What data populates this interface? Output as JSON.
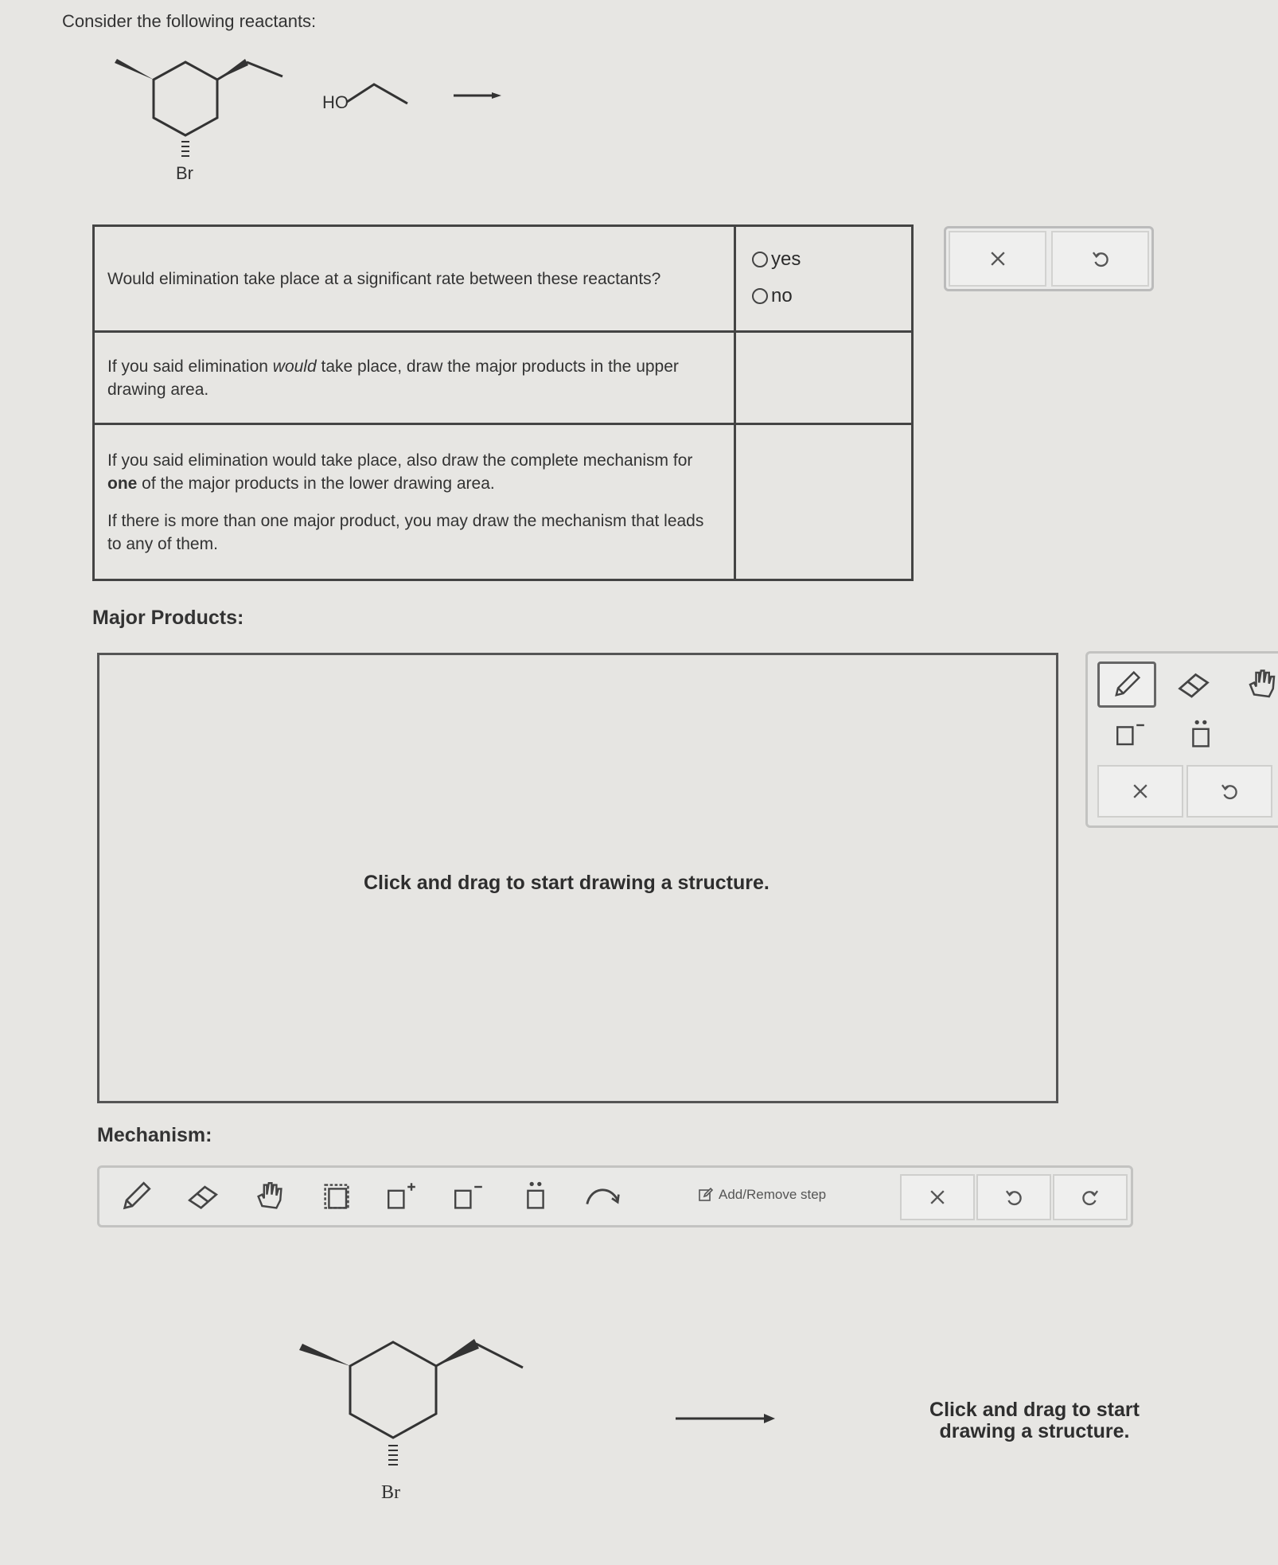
{
  "prompt": "Consider the following reactants:",
  "reactants": {
    "halide_label": "Br",
    "alcohol_label": "HO"
  },
  "questions": [
    {
      "text": "Would elimination take place at a significant rate between these reactants?"
    },
    {
      "text_parts": [
        "If you said elimination ",
        "would",
        " take place, draw the major products in the upper drawing area."
      ]
    },
    {
      "text_parts": [
        "If you said elimination would take place, also draw the complete mechanism for ",
        "one",
        " of the major products in the lower drawing area."
      ],
      "text2": "If there is more than one major product, you may draw the mechanism that leads to any of them."
    }
  ],
  "options": [
    {
      "label": "yes"
    },
    {
      "label": "no"
    }
  ],
  "question_buttons": [
    "close-icon",
    "undo-icon"
  ],
  "major_products": {
    "label": "Major Products:",
    "hint": "Click and drag to start drawing a structure.",
    "tools": [
      "pencil-icon",
      "eraser-icon",
      "hand-icon",
      "negative-charge-icon",
      "lone-pair-icon",
      "close-icon",
      "undo-icon"
    ]
  },
  "mechanism": {
    "label": "Mechanism:",
    "tools": [
      "pencil-icon",
      "eraser-icon",
      "hand-icon",
      "select-box-icon",
      "positive-charge-icon",
      "negative-charge-icon",
      "lone-pair-icon",
      "curved-arrow-icon"
    ],
    "add_remove_step": "Add/Remove step",
    "actions": [
      "close-icon",
      "undo-icon",
      "redo-icon"
    ],
    "structure_label": "Br",
    "hint": "Click and drag to start drawing a structure."
  }
}
